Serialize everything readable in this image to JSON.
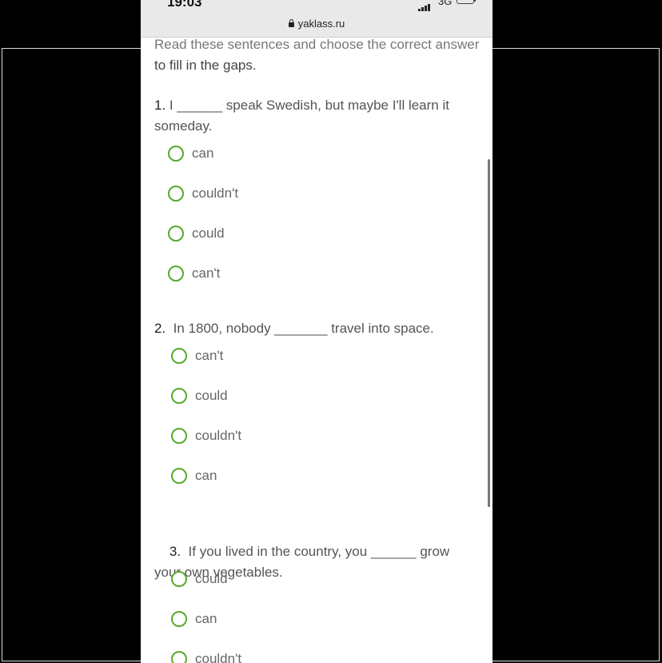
{
  "status_bar": {
    "time": "19:03",
    "network": "3G"
  },
  "browser": {
    "url": "yaklass.ru"
  },
  "intro": {
    "line1": "Read these sentences and choose the correct answer",
    "line2": "to fill in the gaps."
  },
  "questions": [
    {
      "number": "1.",
      "text": " I ______ speak Swedish, but maybe I'll learn it someday.",
      "options": [
        "can",
        "couldn't",
        "could",
        "can't"
      ]
    },
    {
      "number": "2.",
      "text": "  In 1800, nobody _______ travel into space.",
      "options": [
        "can't",
        "could",
        "couldn't",
        "can"
      ]
    },
    {
      "number": "3.",
      "text": "  If you lived in the country, you ______ grow your own vegetables.",
      "options": [
        "could",
        "can",
        "couldn't"
      ]
    }
  ],
  "colors": {
    "radio_border": "#5aa82c",
    "text": "#555555"
  }
}
